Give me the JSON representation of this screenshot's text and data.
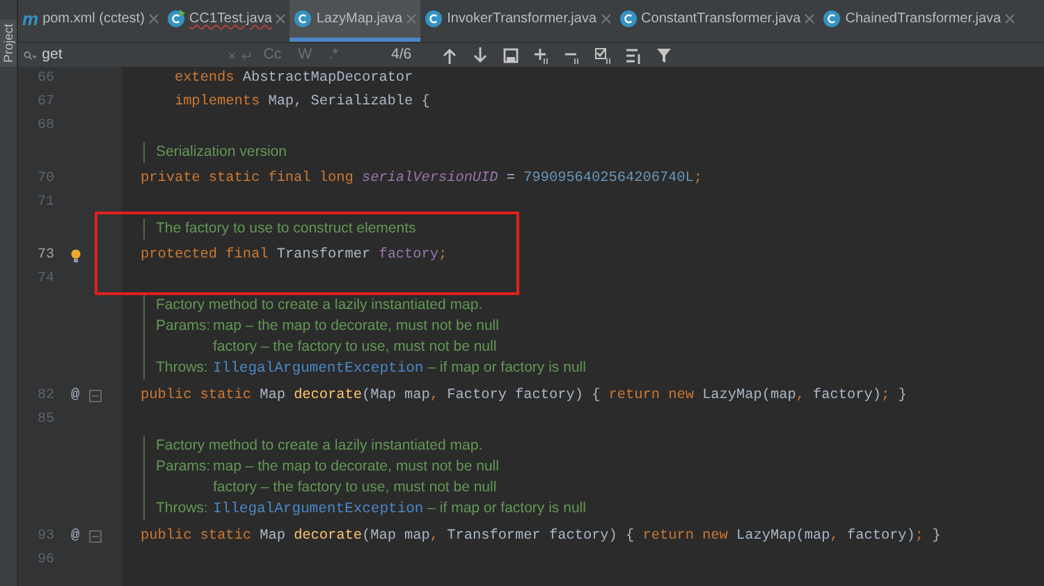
{
  "tool_window_strip": {
    "label": "Project"
  },
  "tabs": [
    {
      "kind": "maven",
      "glyph": "m",
      "label": "pom.xml (cctest)",
      "selected": false,
      "error": false
    },
    {
      "kind": "test-class",
      "label": "CC1Test.java",
      "selected": false,
      "error": true
    },
    {
      "kind": "class",
      "label": "LazyMap.java",
      "selected": true,
      "error": false
    },
    {
      "kind": "class",
      "label": "InvokerTransformer.java",
      "selected": false,
      "error": false
    },
    {
      "kind": "class",
      "label": "ConstantTransformer.java",
      "selected": false,
      "error": false
    },
    {
      "kind": "class",
      "label": "ChainedTransformer.java",
      "selected": false,
      "error": false
    }
  ],
  "search": {
    "value": "get",
    "options": [
      {
        "label": "Cc",
        "selected": false
      },
      {
        "label": "W",
        "selected": false
      },
      {
        "label": ".*",
        "selected": false
      }
    ],
    "match_count": "4/6",
    "tools": [
      {
        "kind": "up"
      },
      {
        "kind": "down"
      },
      {
        "kind": "window"
      },
      {
        "kind": "add"
      },
      {
        "kind": "remove"
      },
      {
        "kind": "select"
      },
      {
        "kind": "lines"
      },
      {
        "kind": "filter"
      }
    ]
  },
  "lines": [
    {
      "kind": "code",
      "number": "66",
      "current": false,
      "bulb": false,
      "fold": false,
      "tokens": [
        {
          "kind": "keyword",
          "s": "    extends "
        },
        {
          "kind": "plain",
          "s": "AbstractMapDecorator"
        }
      ]
    },
    {
      "kind": "code",
      "number": "67",
      "current": false,
      "bulb": false,
      "fold": false,
      "tokens": [
        {
          "kind": "keyword",
          "s": "    implements "
        },
        {
          "kind": "plain",
          "s": "Map, Serializable {"
        }
      ]
    },
    {
      "kind": "code",
      "number": "68",
      "current": false,
      "bulb": false,
      "fold": false
    },
    {
      "kind": "doc",
      "paras": [
        {
          "text": "Serialization version"
        }
      ]
    },
    {
      "kind": "code",
      "number": "70",
      "current": false,
      "bulb": false,
      "fold": false,
      "tokens": [
        {
          "kind": "keyword",
          "s": "private static final long "
        },
        {
          "kind": "static-field",
          "s": "serialVersionUID"
        },
        {
          "kind": "plain",
          "s": " = "
        },
        {
          "kind": "number",
          "s": "7990956402564206740L"
        },
        {
          "kind": "keyword",
          "s": ";"
        }
      ]
    },
    {
      "kind": "code",
      "number": "71",
      "current": false,
      "bulb": false,
      "fold": false
    },
    {
      "kind": "annotated_group",
      "lines": [
        {
          "kind": "doc",
          "paras": [
            {
              "text": "The factory to use to construct elements"
            }
          ]
        },
        {
          "kind": "code",
          "number": "73",
          "current": true,
          "bulb": true,
          "fold": false,
          "tokens": [
            {
              "kind": "keyword",
              "s": "protected final "
            },
            {
              "kind": "plain",
              "s": "Transformer "
            },
            {
              "kind": "field",
              "s": "factory"
            },
            {
              "kind": "keyword",
              "s": ";"
            }
          ]
        },
        {
          "kind": "code",
          "number": "74",
          "current": false,
          "bulb": false,
          "fold": false
        }
      ]
    },
    {
      "kind": "doc",
      "paras": [
        {
          "text": "Factory method to create a lazily instantiated map."
        },
        {
          "label": "Params:",
          "items": [
            "map – the map to decorate, must not be null",
            "factory – the factory to use, must not be null"
          ]
        },
        {
          "label": "Throws:",
          "link": "IllegalArgumentException",
          "rest": " – if map or factory is null"
        }
      ]
    },
    {
      "kind": "code",
      "number": "82",
      "current": false,
      "bulb": false,
      "fold": true,
      "gutter_mark": "@",
      "tokens": [
        {
          "kind": "keyword",
          "s": "public static "
        },
        {
          "kind": "plain",
          "s": "Map "
        },
        {
          "kind": "method",
          "s": "decorate"
        },
        {
          "kind": "plain",
          "s": "(Map map"
        },
        {
          "kind": "keyword",
          "s": ", "
        },
        {
          "kind": "plain",
          "s": "Factory factory) {"
        },
        {
          "kind": "keyword",
          "s": " return new "
        },
        {
          "kind": "plain",
          "s": "LazyMap(map"
        },
        {
          "kind": "keyword",
          "s": ", "
        },
        {
          "kind": "plain",
          "s": "factory)"
        },
        {
          "kind": "keyword",
          "s": "; "
        },
        {
          "kind": "plain",
          "s": "}"
        }
      ]
    },
    {
      "kind": "code",
      "number": "85",
      "current": false,
      "bulb": false,
      "fold": false
    },
    {
      "kind": "doc",
      "paras": [
        {
          "text": "Factory method to create a lazily instantiated map."
        },
        {
          "label": "Params:",
          "items": [
            "map – the map to decorate, must not be null",
            "factory – the factory to use, must not be null"
          ]
        },
        {
          "label": "Throws:",
          "link": "IllegalArgumentException",
          "rest": " – if map or factory is null"
        }
      ]
    },
    {
      "kind": "code",
      "number": "93",
      "current": false,
      "bulb": false,
      "fold": true,
      "gutter_mark": "@",
      "tokens": [
        {
          "kind": "keyword",
          "s": "public static "
        },
        {
          "kind": "plain",
          "s": "Map "
        },
        {
          "kind": "method",
          "s": "decorate"
        },
        {
          "kind": "plain",
          "s": "(Map map"
        },
        {
          "kind": "keyword",
          "s": ", "
        },
        {
          "kind": "plain",
          "s": "Transformer factory) {"
        },
        {
          "kind": "keyword",
          "s": " return new "
        },
        {
          "kind": "plain",
          "s": "LazyMap(map"
        },
        {
          "kind": "keyword",
          "s": ", "
        },
        {
          "kind": "plain",
          "s": "factory)"
        },
        {
          "kind": "keyword",
          "s": "; "
        },
        {
          "kind": "plain",
          "s": "}"
        }
      ]
    },
    {
      "kind": "code",
      "number": "96",
      "current": false,
      "bulb": false,
      "fold": false
    }
  ]
}
